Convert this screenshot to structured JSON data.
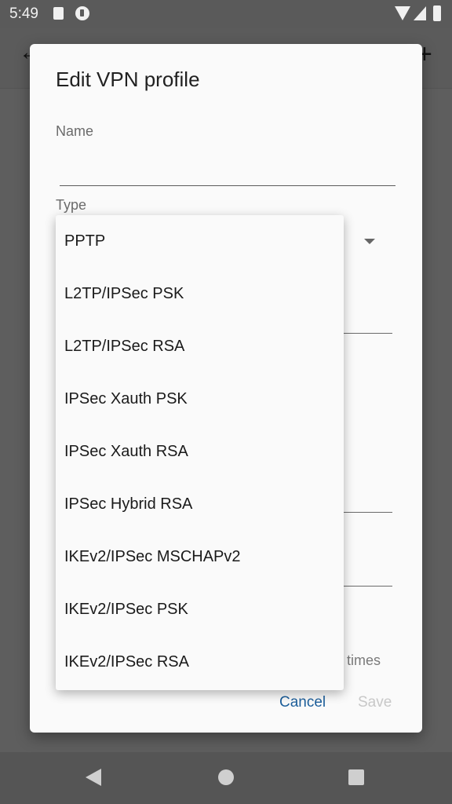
{
  "status_bar": {
    "time": "5:49"
  },
  "dialog": {
    "title": "Edit VPN profile",
    "name_label": "Name",
    "name_value": "",
    "type_label": "Type",
    "partial_text": "times",
    "cancel_label": "Cancel",
    "save_label": "Save"
  },
  "dropdown": {
    "options": [
      "PPTP",
      "L2TP/IPSec PSK",
      "L2TP/IPSec RSA",
      "IPSec Xauth PSK",
      "IPSec Xauth RSA",
      "IPSec Hybrid RSA",
      "IKEv2/IPSec MSCHAPv2",
      "IKEv2/IPSec PSK",
      "IKEv2/IPSec RSA"
    ]
  },
  "colors": {
    "accent": "#1d5f9b",
    "disabled": "#c8c8c8",
    "scrim": "#5e5e5e"
  }
}
